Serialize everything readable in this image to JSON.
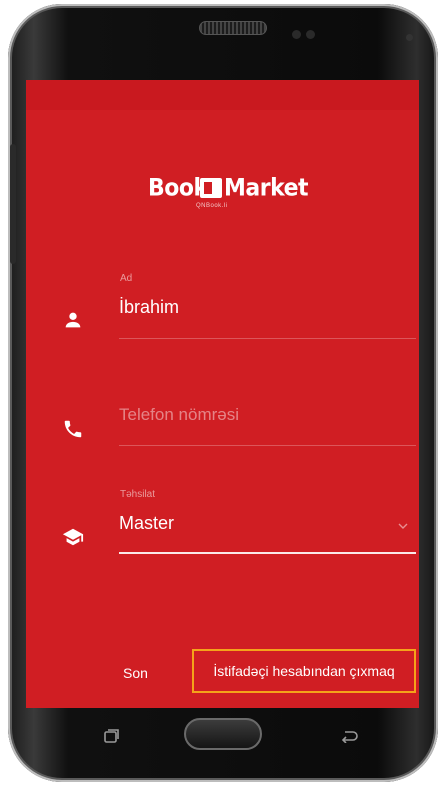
{
  "app": {
    "logo_left": "Book",
    "logo_right": "Market",
    "logo_subtitle": "QNBook.li"
  },
  "form": {
    "name": {
      "label": "Ad",
      "value": "İbrahim",
      "icon": "person-icon"
    },
    "phone": {
      "placeholder": "Telefon nömrəsi",
      "icon": "phone-icon"
    },
    "education": {
      "label": "Təhsilat",
      "value": "Master",
      "icon": "graduation-cap-icon"
    }
  },
  "actions": {
    "son_label": "Son",
    "logout_label": "İstifadəçi hesabından çıxmaq"
  },
  "colors": {
    "screen_bg": "#d01e23",
    "highlight_border": "#f5a31a",
    "text": "#ffffff"
  }
}
